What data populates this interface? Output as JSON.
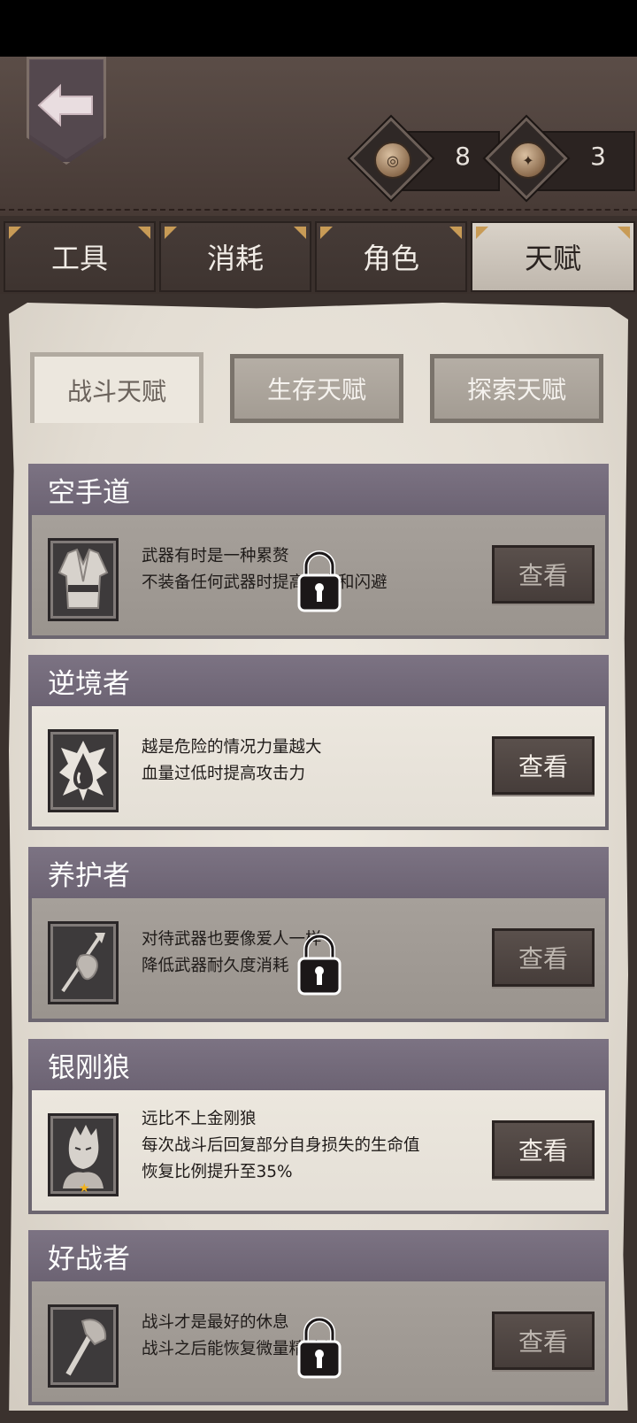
{
  "header": {
    "back_icon": "back-arrow-icon",
    "currencies": [
      {
        "icon": "coin-icon",
        "value": "8"
      },
      {
        "icon": "bird-coin-icon",
        "value": "3"
      }
    ]
  },
  "tabs": [
    {
      "label": "工具",
      "active": false
    },
    {
      "label": "消耗",
      "active": false
    },
    {
      "label": "角色",
      "active": false
    },
    {
      "label": "天赋",
      "active": true
    }
  ],
  "subtabs": [
    {
      "label": "战斗天赋",
      "active": true
    },
    {
      "label": "生存天赋",
      "active": false
    },
    {
      "label": "探索天赋",
      "active": false
    }
  ],
  "view_label": "查看",
  "talents": [
    {
      "title": "空手道",
      "lines": [
        "武器有时是一种累赘",
        "不装备任何武器时提高暴击和闪避"
      ],
      "locked": true,
      "icon": "karate-gi-icon"
    },
    {
      "title": "逆境者",
      "lines": [
        "越是危险的情况力量越大",
        "血量过低时提高攻击力"
      ],
      "locked": false,
      "icon": "blood-drop-icon"
    },
    {
      "title": "养护者",
      "lines": [
        "对待武器也要像爱人一样",
        "降低武器耐久度消耗"
      ],
      "locked": true,
      "icon": "spear-cloth-icon"
    },
    {
      "title": "银刚狼",
      "lines": [
        "远比不上金刚狼",
        "每次战斗后回复部分自身损失的生命值",
        "恢复比例提升至35%"
      ],
      "locked": false,
      "icon": "wolverine-portrait-icon"
    },
    {
      "title": "好战者",
      "lines": [
        "战斗才是最好的休息",
        "战斗之后能恢复微量精神值"
      ],
      "locked": true,
      "icon": "axe-icon"
    }
  ],
  "colors": {
    "accent": "#c89b56",
    "talent_header": "#756c7d",
    "paper": "#e6e1d8"
  }
}
